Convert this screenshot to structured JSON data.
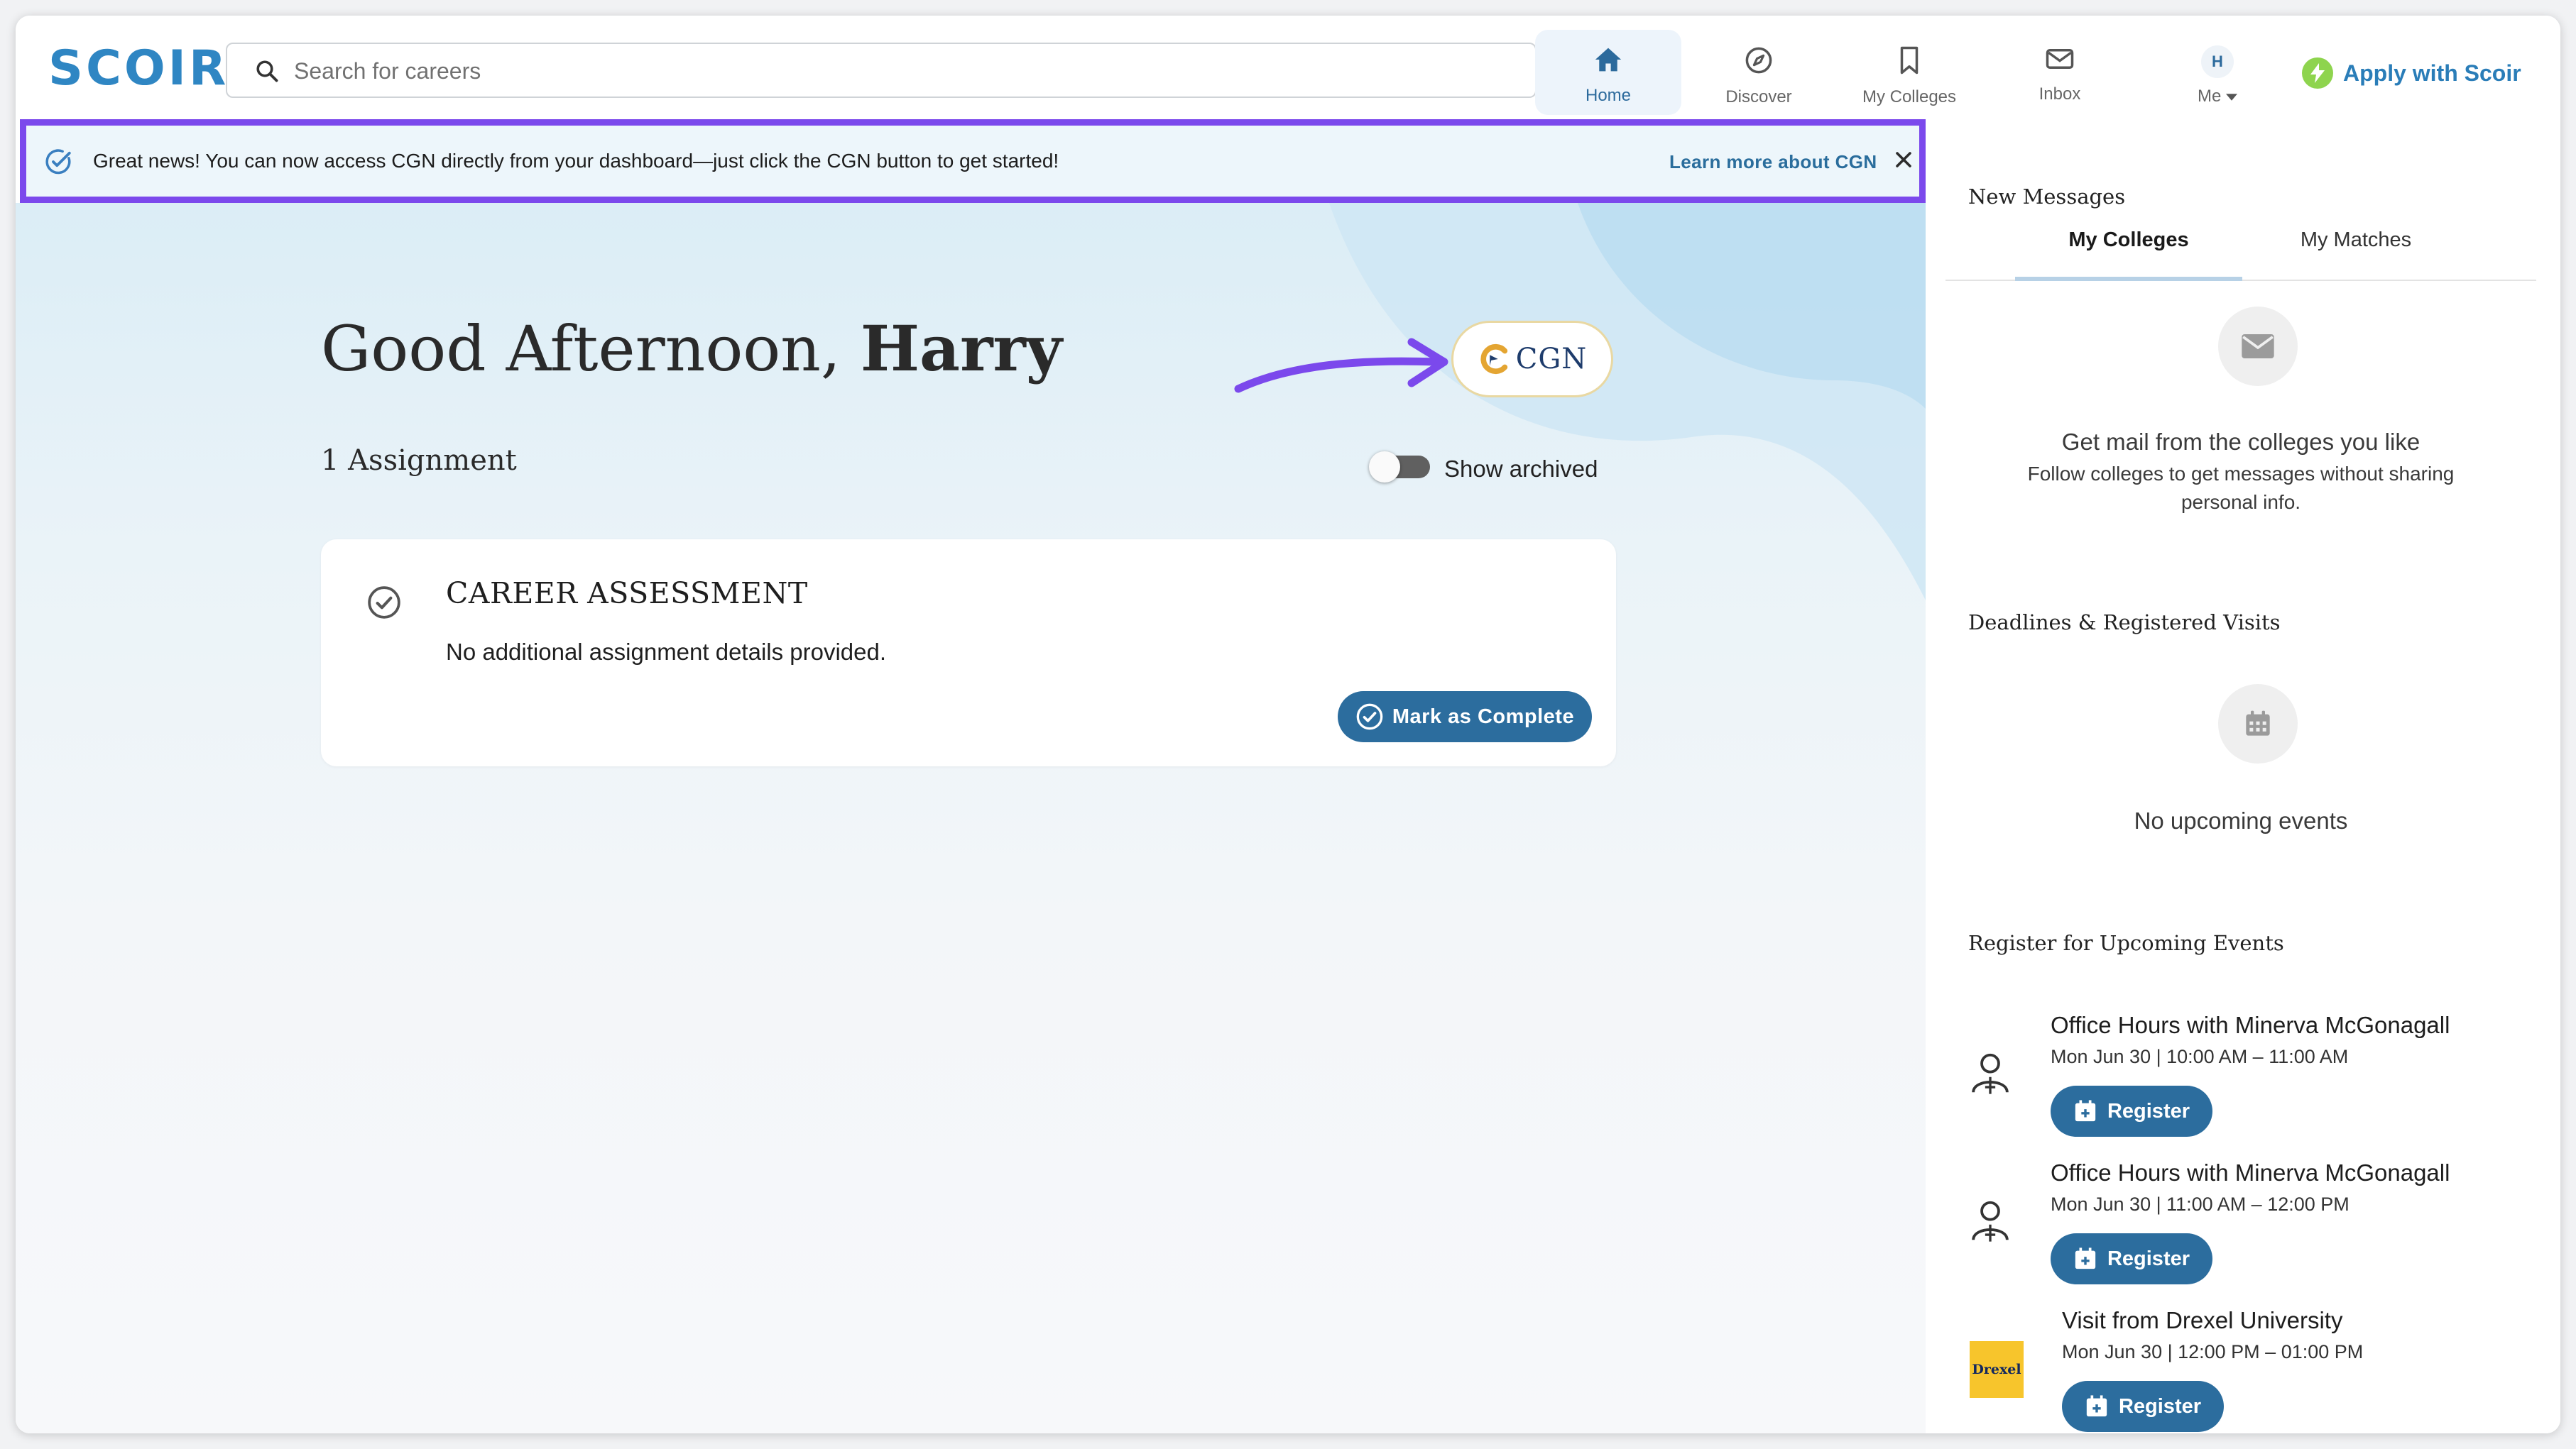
{
  "app": {
    "logo_text": "SCOIR",
    "search_placeholder": "Search for careers",
    "apply_label": "Apply with Scoir",
    "avatar_initial": "H"
  },
  "nav": [
    {
      "label": "Home",
      "icon": "home-icon",
      "active": true
    },
    {
      "label": "Discover",
      "icon": "compass-icon",
      "active": false
    },
    {
      "label": "My Colleges",
      "icon": "bookmark-icon",
      "active": false
    },
    {
      "label": "Inbox",
      "icon": "mail-icon",
      "active": false
    },
    {
      "label": "Me",
      "icon": "avatar",
      "active": false
    }
  ],
  "banner": {
    "text": "Great news! You can now access CGN directly from your dashboard—just click the CGN button to get started!",
    "link": "Learn more about CGN"
  },
  "main": {
    "greeting_prefix": "Good Afternoon, ",
    "greeting_name": "Harry",
    "cgn_label": "CGN",
    "assignment_count": "1 Assignment",
    "show_archived": "Show archived",
    "card": {
      "title": "CAREER ASSESSMENT",
      "description": "No additional assignment details provided.",
      "button": "Mark as Complete"
    }
  },
  "sidebar": {
    "messages_heading": "New Messages",
    "tabs": [
      {
        "label": "My Colleges",
        "active": true
      },
      {
        "label": "My Matches",
        "active": false
      }
    ],
    "messages_empty_title": "Get mail from the colleges you like",
    "messages_empty_sub": "Follow colleges to get messages without sharing personal info.",
    "deadlines_heading": "Deadlines & Registered Visits",
    "deadlines_empty": "No upcoming events",
    "register_heading": "Register for Upcoming Events",
    "events": [
      {
        "title": "Office Hours with Minerva McGonagall",
        "time": "Mon Jun 30 | 10:00 AM – 11:00 AM",
        "button": "Register"
      },
      {
        "title": "Office Hours with Minerva McGonagall",
        "time": "Mon Jun 30 | 11:00 AM – 12:00 PM",
        "button": "Register"
      },
      {
        "title": "Visit from Drexel University",
        "time": "Mon Jun 30 | 12:00 PM – 01:00 PM",
        "button": "Register",
        "logo_text": "Drexel"
      }
    ]
  },
  "colors": {
    "accent": "#2c6d9e",
    "logo": "#2f86c3",
    "highlight_border": "#7b49ec",
    "arrow": "#7b49ec",
    "banner_bg": "#edf6fb",
    "bolt": "#8ed44e"
  }
}
